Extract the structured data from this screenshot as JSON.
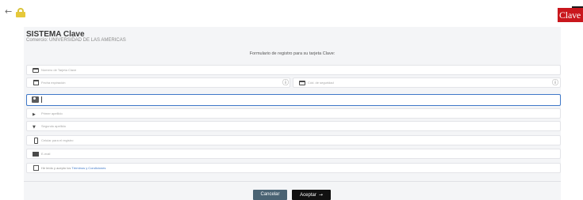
{
  "header": {
    "back_icon": "arrow-left-icon",
    "lock_icon": "lock-icon",
    "brand": "Clave",
    "brand_color": "#c9171d"
  },
  "panel": {
    "title": "SISTEMA Clave",
    "merchant": "Comercio: UNIVERSIDAD DE LAS AMERICAS",
    "form_title": "Formulario de registro para su tarjeta Clave:"
  },
  "form": {
    "card_number": {
      "placeholder": "Número de Tarjeta Clave",
      "icon": "credit-card-icon"
    },
    "expiry": {
      "placeholder": "Fecha expiración",
      "icon": "calendar-icon",
      "help": "?"
    },
    "security_code": {
      "placeholder": "Cód. de seguridad",
      "icon": "card-icon",
      "help": "?"
    },
    "id_field": {
      "icon": "id-card-icon",
      "value": ""
    },
    "first_surname": {
      "placeholder": "Primer apellido",
      "icon": "chevron-right-icon"
    },
    "second_surname": {
      "placeholder": "Segundo apellido",
      "icon": "chevron-down-icon"
    },
    "mobile": {
      "placeholder": "Celular para el registro",
      "icon": "phone-icon"
    },
    "email": {
      "placeholder": "E-mail",
      "icon": "mail-icon"
    },
    "terms": {
      "prefix": "He leído y acepto los ",
      "link": "Términos y Condiciones",
      "checked": false
    }
  },
  "actions": {
    "cancel_label": "Cancelar",
    "accept_label": "Aceptar",
    "accept_icon": "arrow-right-icon"
  },
  "colors": {
    "accent_border": "#3f78c8",
    "cancel_bg": "#4a6373",
    "accept_bg": "#111111",
    "panel_bg": "#f4f5f7"
  }
}
